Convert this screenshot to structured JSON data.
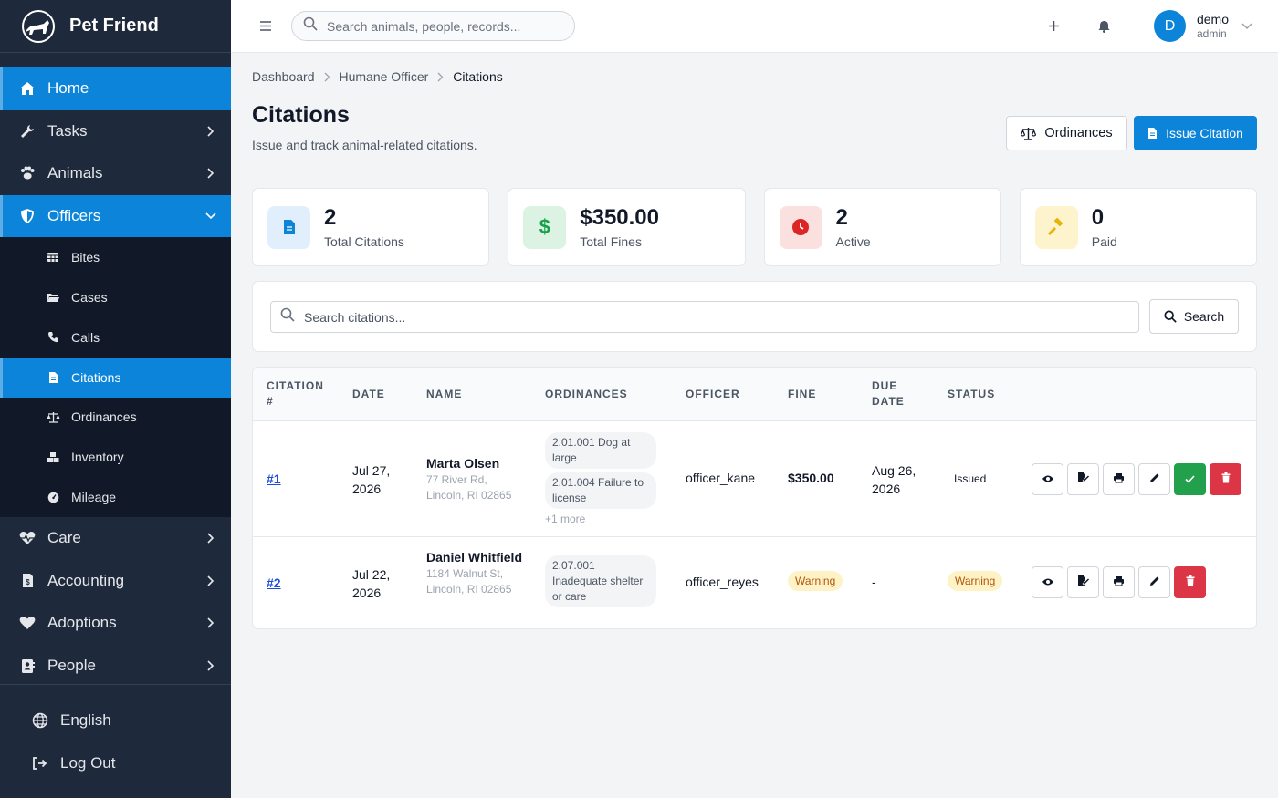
{
  "app": {
    "name": "Pet Friend"
  },
  "sidebar": {
    "items": [
      {
        "label": "Home",
        "icon": "home-icon"
      },
      {
        "label": "Tasks",
        "icon": "wrench-icon"
      },
      {
        "label": "Animals",
        "icon": "paw-icon"
      },
      {
        "label": "Officers",
        "icon": "shield-icon"
      },
      {
        "label": "Care",
        "icon": "heartbeat-icon"
      },
      {
        "label": "Accounting",
        "icon": "invoice-icon"
      },
      {
        "label": "Adoptions",
        "icon": "heart-icon"
      },
      {
        "label": "People",
        "icon": "contact-icon"
      }
    ],
    "officers_sub": [
      {
        "label": "Bites",
        "icon": "table-icon"
      },
      {
        "label": "Cases",
        "icon": "folder-icon"
      },
      {
        "label": "Calls",
        "icon": "phone-icon"
      },
      {
        "label": "Citations",
        "icon": "file-icon"
      },
      {
        "label": "Ordinances",
        "icon": "scale-icon"
      },
      {
        "label": "Inventory",
        "icon": "boxes-icon"
      },
      {
        "label": "Mileage",
        "icon": "gauge-icon"
      }
    ],
    "bottom": [
      {
        "label": "English",
        "icon": "globe-icon"
      },
      {
        "label": "Log Out",
        "icon": "logout-icon"
      }
    ]
  },
  "topbar": {
    "search_placeholder": "Search animals, people, records...",
    "avatar_initial": "D",
    "user_name": "demo",
    "user_role": "admin"
  },
  "breadcrumb": [
    "Dashboard",
    "Humane Officer",
    "Citations"
  ],
  "page": {
    "title": "Citations",
    "subtitle": "Issue and track animal-related citations.",
    "ordinances_btn": "Ordinances",
    "issue_btn": "Issue Citation"
  },
  "stats": [
    {
      "value": "2",
      "label": "Total Citations",
      "icon": "file-icon",
      "color": "#0b84d9"
    },
    {
      "value": "$350.00",
      "label": "Total Fines",
      "icon": "dollar-icon",
      "color": "#16a34a"
    },
    {
      "value": "2",
      "label": "Active",
      "icon": "clock-icon",
      "color": "#dc2626"
    },
    {
      "value": "0",
      "label": "Paid",
      "icon": "gavel-icon",
      "color": "#eab308"
    }
  ],
  "search": {
    "placeholder": "Search citations...",
    "button": "Search"
  },
  "table": {
    "headers": [
      "CITATION #",
      "DATE",
      "NAME",
      "ORDINANCES",
      "OFFICER",
      "FINE",
      "DUE DATE",
      "STATUS"
    ],
    "rows": [
      {
        "id": "#1",
        "date": "Jul 27, 2026",
        "name": "Marta Olsen",
        "address": "77 River Rd, Lincoln, RI 02865",
        "ordinances": [
          "2.01.001 Dog at large",
          "2.01.004 Failure to license"
        ],
        "more": "+1 more",
        "officer": "officer_kane",
        "fine": "$350.00",
        "due": "Aug 26, 2026",
        "status": "Issued"
      },
      {
        "id": "#2",
        "date": "Jul 22, 2026",
        "name": "Daniel Whitfield",
        "address": "1184 Walnut St, Lincoln, RI 02865",
        "ordinances": [
          "2.07.001 Inadequate shelter or care"
        ],
        "officer": "officer_reyes",
        "fine": "Warning",
        "due": "-",
        "status": "Warning"
      }
    ]
  }
}
